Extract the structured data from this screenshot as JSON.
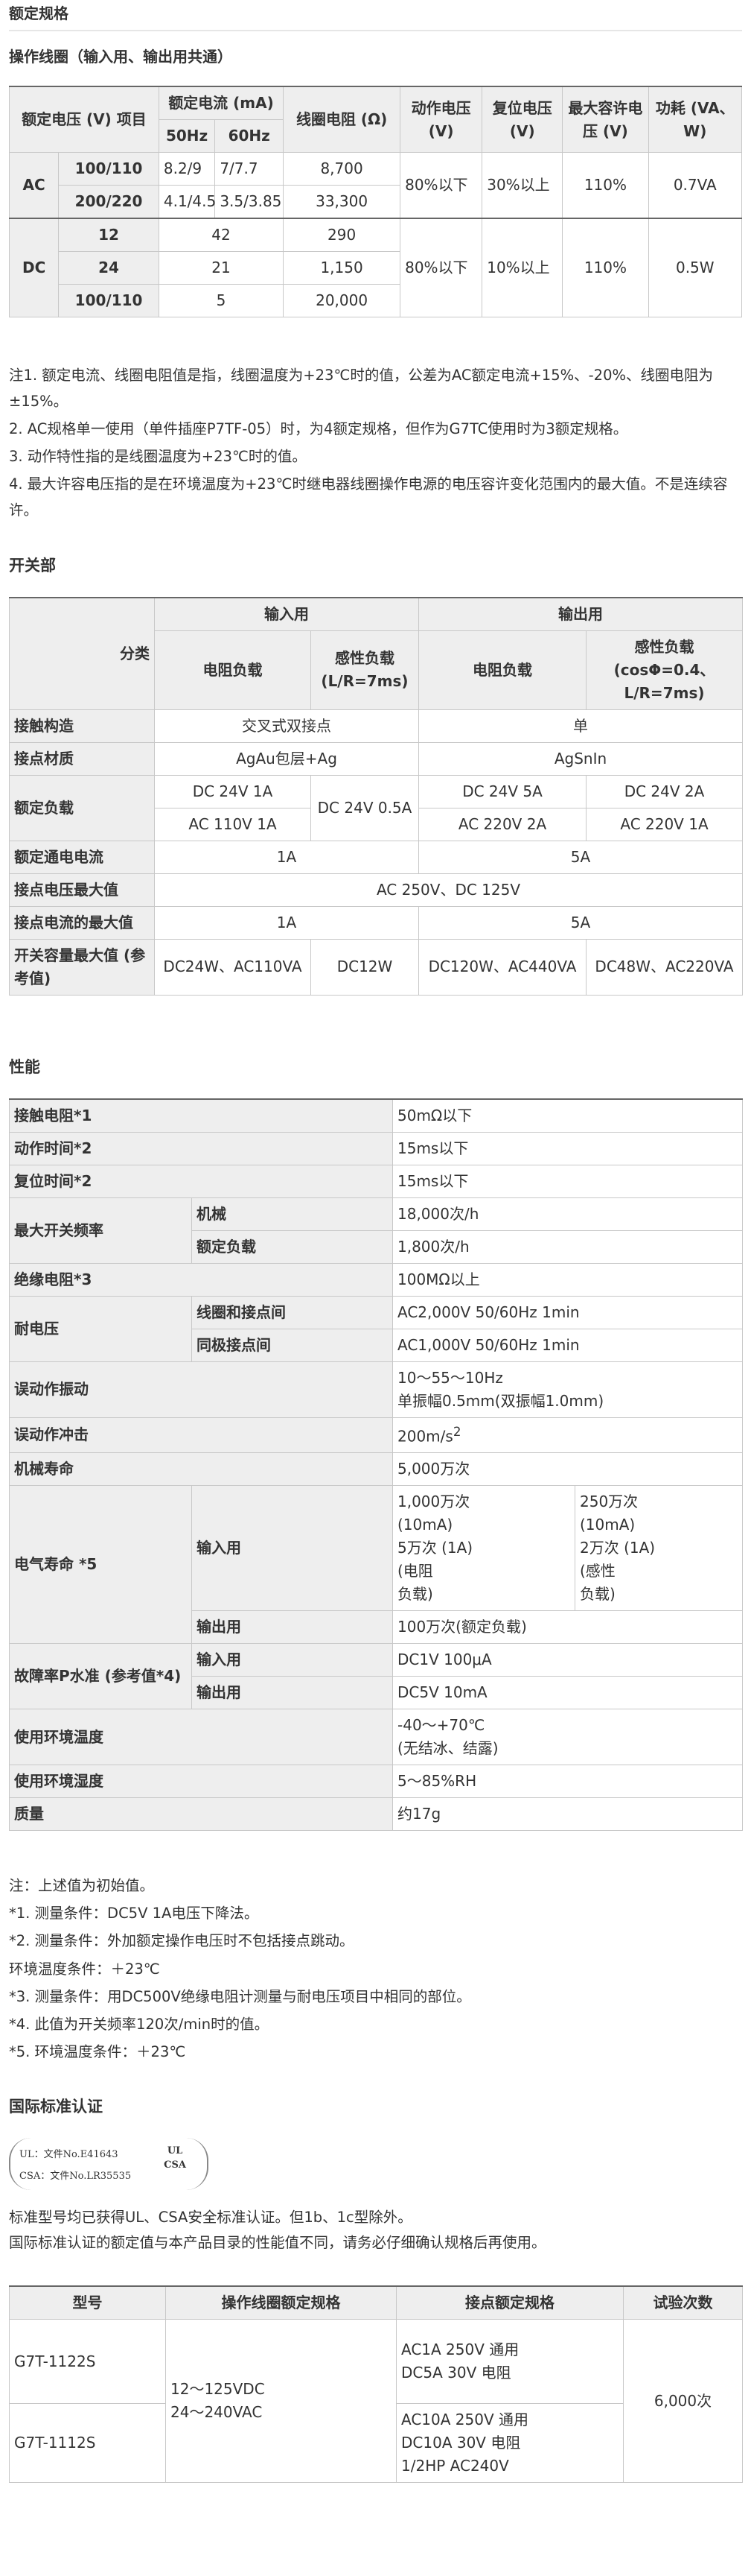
{
  "page_title": "额定规格",
  "coil": {
    "title": "操作线圈（输入用、输出用共通）",
    "headers": {
      "item": "额定电压 (V) 项目",
      "current": "额定电流 (mA)",
      "hz50": "50Hz",
      "hz60": "60Hz",
      "resistance": "线圈电阻 (Ω)",
      "operate": "动作电压 (V)",
      "release": "复位电压 (V)",
      "max": "最大容许电压 (V)",
      "power": "功耗 (VA、W)"
    },
    "ac": {
      "label": "AC",
      "rows": [
        {
          "voltage": "100/110",
          "c50": "8.2/9",
          "c60": "7/7.7",
          "res": "8,700"
        },
        {
          "voltage": "200/220",
          "c50": "4.1/4.5",
          "c60": "3.5/3.85",
          "res": "33,300"
        }
      ],
      "operate": "80%以下",
      "release": "30%以上",
      "max": "110%",
      "power": "0.7VA"
    },
    "dc": {
      "label": "DC",
      "rows": [
        {
          "voltage": "12",
          "current": "42",
          "res": "290"
        },
        {
          "voltage": "24",
          "current": "21",
          "res": "1,150"
        },
        {
          "voltage": "100/110",
          "current": "5",
          "res": "20,000"
        }
      ],
      "operate": "80%以下",
      "release": "10%以上",
      "max": "110%",
      "power": "0.5W"
    },
    "notes": [
      "注1. 额定电流、线圈电阻值是指，线圈温度为+23℃时的值，公差为AC额定电流+15%、-20%、线圈电阻为±15%。",
      "2. AC规格单一使用（单件插座P7TF-05）时，为4额定规格，但作为G7TC使用时为3额定规格。",
      "3. 动作特性指的是线圈温度为+23℃时的值。",
      "4. 最大许容电压指的是在环境温度为+23℃时继电器线圈操作电源的电压容许变化范围内的最大值。不是连续容许。"
    ]
  },
  "switch": {
    "title": "开关部",
    "headers": {
      "category": "分类",
      "input": "输入用",
      "output": "输出用",
      "in_res": "电阻负载",
      "in_ind": "感性负载 (L/R=7ms)",
      "out_res": "电阻负载",
      "out_ind": "感性负载 (cosΦ=0.4、L/R=7ms)"
    },
    "rows": {
      "structure": {
        "label": "接触构造",
        "input": "交叉式双接点",
        "output": "单"
      },
      "material": {
        "label": "接点材质",
        "input": "AgAu包层+Ag",
        "output": "AgSnIn"
      },
      "rated_load": {
        "label": "额定负载",
        "in_res_1": "DC 24V 1A",
        "in_res_2": "AC 110V 1A",
        "in_ind": "DC 24V 0.5A",
        "out_res_1": "DC 24V 5A",
        "out_res_2": "AC 220V 2A",
        "out_ind_1": "DC 24V 2A",
        "out_ind_2": "AC 220V 1A"
      },
      "carry": {
        "label": "额定通电电流",
        "input": "1A",
        "output": "5A"
      },
      "max_voltage": {
        "label": "接点电压最大值",
        "value": "AC 250V、DC 125V"
      },
      "max_current": {
        "label": "接点电流的最大值",
        "input": "1A",
        "output": "5A"
      },
      "max_capacity": {
        "label": "开关容量最大值 (参考值)",
        "in_res": "DC24W、AC110VA",
        "in_ind": "DC12W",
        "out_res": "DC120W、AC440VA",
        "out_ind": "DC48W、AC220VA"
      }
    }
  },
  "performance": {
    "title": "性能",
    "contact_resistance": {
      "label": "接触电阻*1",
      "value": "50mΩ以下"
    },
    "operate_time": {
      "label": "动作时间*2",
      "value": "15ms以下"
    },
    "release_time": {
      "label": "复位时间*2",
      "value": "15ms以下"
    },
    "max_freq": {
      "label": "最大开关频率",
      "mech": "机械",
      "mech_val": "18,000次/h",
      "rated": "额定负载",
      "rated_val": "1,800次/h"
    },
    "insulation": {
      "label": "绝缘电阻*3",
      "value": "100MΩ以上"
    },
    "dielectric": {
      "label": "耐电压",
      "a": "线圈和接点间",
      "a_val": "AC2,000V 50/60Hz 1min",
      "b": "同极接点间",
      "b_val": "AC1,000V 50/60Hz 1min"
    },
    "vibration": {
      "label": "误动作振动",
      "line1": "10～55～10Hz",
      "line2": "单振幅0.5mm(双振幅1.0mm)"
    },
    "shock": {
      "label": "误动作冲击",
      "value": "200m/s",
      "sup": "2"
    },
    "mech_life": {
      "label": "机械寿命",
      "value": "5,000万次"
    },
    "elec_life": {
      "label": "电气寿命 *5",
      "input": "输入用",
      "in_res": [
        "1,000万次",
        "(10mA)",
        "5万次 (1A)",
        "(电阻",
        "负载)"
      ],
      "in_ind": [
        "250万次",
        "(10mA)",
        "2万次 (1A)",
        "(感性",
        "负载)"
      ],
      "output": "输出用",
      "out_val": "100万次(额定负载)"
    },
    "failure": {
      "label": "故障率P水准 (参考值*4)",
      "input": "输入用",
      "in_val": "DC1V 100μA",
      "output": "输出用",
      "out_val": "DC5V 10mA"
    },
    "amb_temp": {
      "label": "使用环境温度",
      "line1": "-40～+70℃",
      "line2": "(无结冰、结露)"
    },
    "amb_hum": {
      "label": "使用环境湿度",
      "value": "5～85%RH"
    },
    "mass": {
      "label": "质量",
      "value": "约17g"
    },
    "notes": [
      "注：上述值为初始值。",
      "*1. 测量条件：DC5V 1A电压下降法。",
      "*2. 测量条件：外加额定操作电压时不包括接点跳动。",
      "环境温度条件：＋23℃",
      "*3. 测量条件：用DC500V绝缘电阻计测量与耐电压项目中相同的部位。",
      "*4. 此值为开关频率120次/min时的值。",
      "*5. 环境温度条件：＋23℃"
    ]
  },
  "cert": {
    "title": "国际标准认证",
    "logo_line1": "UL：文件No.E41643",
    "logo_line2": "CSA：文件No.LR35535",
    "logo_mark1": "UL",
    "logo_mark2": "CSA",
    "para1": "标准型号均已获得UL、CSA安全标准认证。但1b、1c型除外。",
    "para2": "国际标准认证的额定值与本产品目录的性能值不同，请务必仔细确认规格后再使用。",
    "headers": {
      "model": "型号",
      "coil": "操作线圈额定规格",
      "contact": "接点额定规格",
      "count": "试验次数"
    },
    "coil_line1": "12～125VDC",
    "coil_line2": "24～240VAC",
    "count": "6,000次",
    "rows": [
      {
        "model": "G7T-1122S",
        "contact": [
          "AC1A 250V 通用",
          "DC5A 30V 电阻"
        ]
      },
      {
        "model": "G7T-1112S",
        "contact": [
          "AC10A 250V 通用",
          "DC10A 30V 电阻",
          "1/2HP AC240V"
        ]
      }
    ]
  }
}
